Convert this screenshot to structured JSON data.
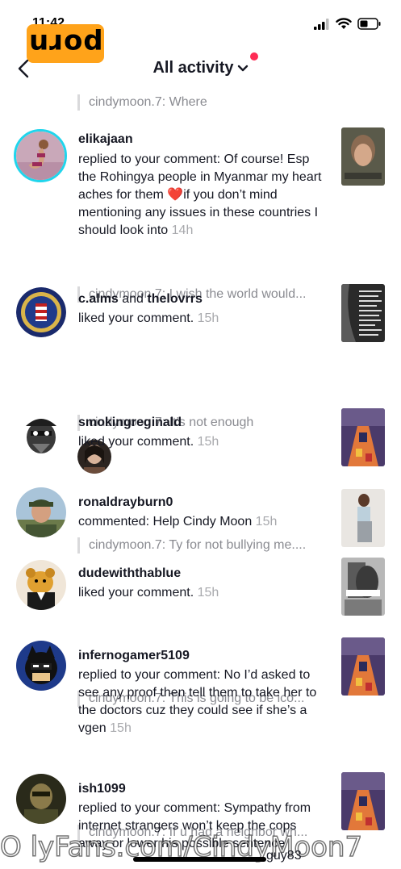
{
  "status_bar": {
    "time": "11:42"
  },
  "watermark_logo": "porn",
  "header": {
    "title": "All activity"
  },
  "top_quote": "cindymoon.7: Where",
  "items": [
    {
      "username": "elikajaan",
      "text": "replied to your comment: Of course! Esp the Rohingya people in Myanmar my heart aches for them ❤️if you don’t mind mentioning any issues in these countries I should look into",
      "time": "14h",
      "quote": "cindymoon.7: I wish the world would..."
    },
    {
      "username": "c.alms",
      "joiner": " and ",
      "username2": "thelovrrs",
      "text": "liked your comment.",
      "time": "15h",
      "quote": "cindymoon.7: It’s not enough"
    },
    {
      "username": "smokingreginald",
      "text": "liked your comment.",
      "time": "15h",
      "quote": "cindymoon.7: Ty for not bullying me...."
    },
    {
      "username": "ronaldrayburn0",
      "text": "commented: Help Cindy Moon",
      "time": "15h"
    },
    {
      "username": "dudewiththablue",
      "text": "liked your comment.",
      "time": "15h",
      "quote": "cindymoon.7: This is going to be ico..."
    },
    {
      "username": "infernogamer5109",
      "text": "replied to your comment: No I’d asked to see any proof then tell them to take her to the doctors cuz they could see if she’s a vgen",
      "time": "15h",
      "quote": "cindymoon.7: If u had a neighbor wh..."
    },
    {
      "username": "ish1099",
      "text": "replied to your comment: Sympathy from internet strangers won’t keep the cops away or lower his possible sentence",
      "time": ""
    }
  ],
  "watermark_text": "O lyFans.com/CindyMoon7",
  "watermark_overlay": "guy83",
  "colors": {
    "accent_dot": "#fe2c55",
    "logo_bg": "#ffa31a",
    "gray_text": "#8a8b91"
  }
}
